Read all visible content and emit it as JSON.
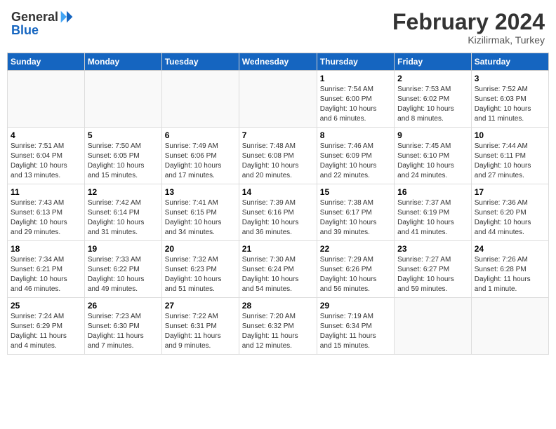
{
  "header": {
    "logo_general": "General",
    "logo_blue": "Blue",
    "month_year": "February 2024",
    "location": "Kizilirmak, Turkey"
  },
  "weekdays": [
    "Sunday",
    "Monday",
    "Tuesday",
    "Wednesday",
    "Thursday",
    "Friday",
    "Saturday"
  ],
  "weeks": [
    [
      {
        "day": "",
        "info": ""
      },
      {
        "day": "",
        "info": ""
      },
      {
        "day": "",
        "info": ""
      },
      {
        "day": "",
        "info": ""
      },
      {
        "day": "1",
        "info": "Sunrise: 7:54 AM\nSunset: 6:00 PM\nDaylight: 10 hours\nand 6 minutes."
      },
      {
        "day": "2",
        "info": "Sunrise: 7:53 AM\nSunset: 6:02 PM\nDaylight: 10 hours\nand 8 minutes."
      },
      {
        "day": "3",
        "info": "Sunrise: 7:52 AM\nSunset: 6:03 PM\nDaylight: 10 hours\nand 11 minutes."
      }
    ],
    [
      {
        "day": "4",
        "info": "Sunrise: 7:51 AM\nSunset: 6:04 PM\nDaylight: 10 hours\nand 13 minutes."
      },
      {
        "day": "5",
        "info": "Sunrise: 7:50 AM\nSunset: 6:05 PM\nDaylight: 10 hours\nand 15 minutes."
      },
      {
        "day": "6",
        "info": "Sunrise: 7:49 AM\nSunset: 6:06 PM\nDaylight: 10 hours\nand 17 minutes."
      },
      {
        "day": "7",
        "info": "Sunrise: 7:48 AM\nSunset: 6:08 PM\nDaylight: 10 hours\nand 20 minutes."
      },
      {
        "day": "8",
        "info": "Sunrise: 7:46 AM\nSunset: 6:09 PM\nDaylight: 10 hours\nand 22 minutes."
      },
      {
        "day": "9",
        "info": "Sunrise: 7:45 AM\nSunset: 6:10 PM\nDaylight: 10 hours\nand 24 minutes."
      },
      {
        "day": "10",
        "info": "Sunrise: 7:44 AM\nSunset: 6:11 PM\nDaylight: 10 hours\nand 27 minutes."
      }
    ],
    [
      {
        "day": "11",
        "info": "Sunrise: 7:43 AM\nSunset: 6:13 PM\nDaylight: 10 hours\nand 29 minutes."
      },
      {
        "day": "12",
        "info": "Sunrise: 7:42 AM\nSunset: 6:14 PM\nDaylight: 10 hours\nand 31 minutes."
      },
      {
        "day": "13",
        "info": "Sunrise: 7:41 AM\nSunset: 6:15 PM\nDaylight: 10 hours\nand 34 minutes."
      },
      {
        "day": "14",
        "info": "Sunrise: 7:39 AM\nSunset: 6:16 PM\nDaylight: 10 hours\nand 36 minutes."
      },
      {
        "day": "15",
        "info": "Sunrise: 7:38 AM\nSunset: 6:17 PM\nDaylight: 10 hours\nand 39 minutes."
      },
      {
        "day": "16",
        "info": "Sunrise: 7:37 AM\nSunset: 6:19 PM\nDaylight: 10 hours\nand 41 minutes."
      },
      {
        "day": "17",
        "info": "Sunrise: 7:36 AM\nSunset: 6:20 PM\nDaylight: 10 hours\nand 44 minutes."
      }
    ],
    [
      {
        "day": "18",
        "info": "Sunrise: 7:34 AM\nSunset: 6:21 PM\nDaylight: 10 hours\nand 46 minutes."
      },
      {
        "day": "19",
        "info": "Sunrise: 7:33 AM\nSunset: 6:22 PM\nDaylight: 10 hours\nand 49 minutes."
      },
      {
        "day": "20",
        "info": "Sunrise: 7:32 AM\nSunset: 6:23 PM\nDaylight: 10 hours\nand 51 minutes."
      },
      {
        "day": "21",
        "info": "Sunrise: 7:30 AM\nSunset: 6:24 PM\nDaylight: 10 hours\nand 54 minutes."
      },
      {
        "day": "22",
        "info": "Sunrise: 7:29 AM\nSunset: 6:26 PM\nDaylight: 10 hours\nand 56 minutes."
      },
      {
        "day": "23",
        "info": "Sunrise: 7:27 AM\nSunset: 6:27 PM\nDaylight: 10 hours\nand 59 minutes."
      },
      {
        "day": "24",
        "info": "Sunrise: 7:26 AM\nSunset: 6:28 PM\nDaylight: 11 hours\nand 1 minute."
      }
    ],
    [
      {
        "day": "25",
        "info": "Sunrise: 7:24 AM\nSunset: 6:29 PM\nDaylight: 11 hours\nand 4 minutes."
      },
      {
        "day": "26",
        "info": "Sunrise: 7:23 AM\nSunset: 6:30 PM\nDaylight: 11 hours\nand 7 minutes."
      },
      {
        "day": "27",
        "info": "Sunrise: 7:22 AM\nSunset: 6:31 PM\nDaylight: 11 hours\nand 9 minutes."
      },
      {
        "day": "28",
        "info": "Sunrise: 7:20 AM\nSunset: 6:32 PM\nDaylight: 11 hours\nand 12 minutes."
      },
      {
        "day": "29",
        "info": "Sunrise: 7:19 AM\nSunset: 6:34 PM\nDaylight: 11 hours\nand 15 minutes."
      },
      {
        "day": "",
        "info": ""
      },
      {
        "day": "",
        "info": ""
      }
    ]
  ]
}
